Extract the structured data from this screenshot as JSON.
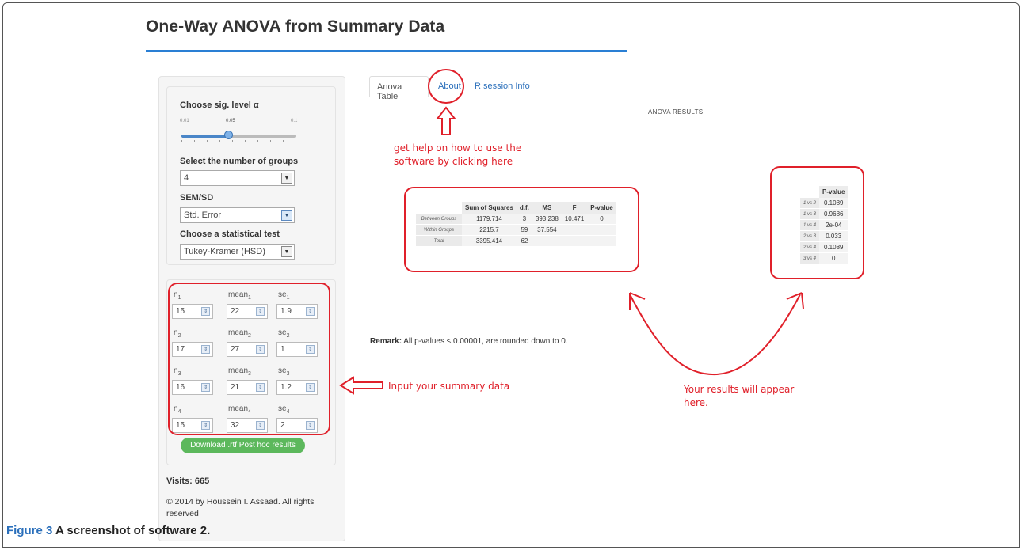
{
  "page": {
    "title": "One-Way ANOVA from Summary Data"
  },
  "sidebar": {
    "sig_level": {
      "label": "Choose sig. level α",
      "min": "0.01",
      "value": "0.05",
      "max": "0.1"
    },
    "groups": {
      "label": "Select the number of groups",
      "value": "4"
    },
    "sem_sd": {
      "label": "SEM/SD",
      "value": "Std. Error"
    },
    "test": {
      "label": "Choose a statistical test",
      "value": "Tukey-Kramer (HSD)"
    },
    "inputs": [
      {
        "n_label": "n",
        "sub": "1",
        "mean_label": "mean",
        "se_label": "se",
        "n": "15",
        "mean": "22",
        "se": "1.9"
      },
      {
        "n_label": "n",
        "sub": "2",
        "mean_label": "mean",
        "se_label": "se",
        "n": "17",
        "mean": "27",
        "se": "1"
      },
      {
        "n_label": "n",
        "sub": "3",
        "mean_label": "mean",
        "se_label": "se",
        "n": "16",
        "mean": "21",
        "se": "1.2"
      },
      {
        "n_label": "n",
        "sub": "4",
        "mean_label": "mean",
        "se_label": "se",
        "n": "15",
        "mean": "32",
        "se": "2"
      }
    ],
    "download_label": "Download .rtf Post hoc results",
    "visits": "Visits: 665",
    "copyright": "© 2014 by Houssein I. Assaad. All rights reserved"
  },
  "tabs": [
    {
      "label": "Anova Table"
    },
    {
      "label": "About"
    },
    {
      "label": "R session Info"
    }
  ],
  "results": {
    "heading": "ANOVA RESULTS",
    "anova": {
      "headers": [
        "Sum of Squares",
        "d.f.",
        "MS",
        "F",
        "P-value"
      ],
      "rows": [
        {
          "name": "Between Groups",
          "cells": [
            "1179.714",
            "3",
            "393.238",
            "10.471",
            "0"
          ]
        },
        {
          "name": "Within Groups",
          "cells": [
            "2215.7",
            "59",
            "37.554",
            "",
            ""
          ]
        },
        {
          "name": "Total",
          "cells": [
            "3395.414",
            "62",
            "",
            "",
            ""
          ]
        }
      ]
    },
    "posthoc": {
      "header": "P-value",
      "rows": [
        {
          "name": "1 vs 2",
          "value": "0.1089"
        },
        {
          "name": "1 vs 3",
          "value": "0.9686"
        },
        {
          "name": "1 vs 4",
          "value": "2e-04"
        },
        {
          "name": "2 vs 3",
          "value": "0.033"
        },
        {
          "name": "2 vs 4",
          "value": "0.1089"
        },
        {
          "name": "3 vs 4",
          "value": "0"
        }
      ]
    },
    "remark_bold": "Remark:",
    "remark_text": " All p-values ≤ 0.00001, are rounded down to 0."
  },
  "annotations": {
    "help": "get help on how to use the software by clicking here",
    "input": "Input your summary data",
    "results": "Your results will appear here."
  },
  "caption": {
    "figure": "Figure 3",
    "text": " A screenshot of software 2."
  },
  "colors": {
    "accent": "#2a7fd4",
    "annotation": "#e0202a",
    "button": "#5cb85c"
  }
}
